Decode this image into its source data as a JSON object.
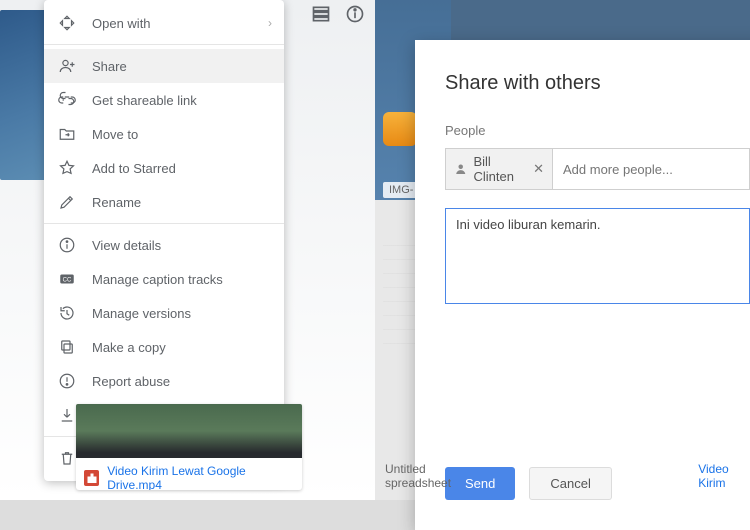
{
  "colors": {
    "accent_blue": "#4a86e8",
    "link_blue": "#1a73e8",
    "danger_red": "#d34836",
    "gray_text": "#5f6368"
  },
  "left": {
    "context_menu": [
      {
        "label": "Open with",
        "has_submenu": true
      },
      {
        "label": "Share"
      },
      {
        "label": "Get shareable link"
      },
      {
        "label": "Move to"
      },
      {
        "label": "Add to Starred"
      },
      {
        "label": "Rename"
      },
      {
        "label": "View details"
      },
      {
        "label": "Manage caption tracks"
      },
      {
        "label": "Manage versions"
      },
      {
        "label": "Make a copy"
      },
      {
        "label": "Report abuse"
      },
      {
        "label": "Download"
      },
      {
        "label": "Remove"
      }
    ],
    "file_name": "Video Kirim Lewat Google Drive.mp4"
  },
  "right": {
    "bg_file_stub": "IMG-",
    "dialog": {
      "title": "Share with others",
      "people_label": "People",
      "chip_name": "Bill Clinten",
      "add_placeholder": "Add more people...",
      "message_text": "Ini video liburan kemarin.",
      "send_label": "Send",
      "cancel_label": "Cancel"
    },
    "bottom_files": {
      "spreadsheet": "Untitled spreadsheet",
      "video": "Video Kirim"
    }
  }
}
